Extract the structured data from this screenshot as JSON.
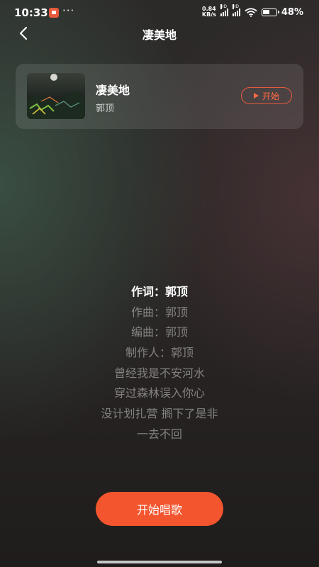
{
  "status_bar": {
    "time": "10:33",
    "more": "···",
    "net_speed_value": "0.84",
    "net_speed_unit": "KB/s",
    "signal1_tag": "HD",
    "signal2_tag": "HD",
    "battery": "48%"
  },
  "nav": {
    "title": "凄美地",
    "back_icon": "chevron-left-icon"
  },
  "song_card": {
    "title": "凄美地",
    "artist": "郭顶",
    "start_label": "开始",
    "play_icon": "play-icon"
  },
  "lyrics": [
    "作词：郭顶",
    "作曲：郭顶",
    "编曲：郭顶",
    "制作人：郭顶",
    "曾经我是不安河水",
    "穿过森林误入你心",
    "没计划扎营 搁下了是非",
    "一去不回"
  ],
  "actions": {
    "sing_label": "开始唱歌"
  },
  "colors": {
    "accent": "#f3552f",
    "start_outline": "#e8593d"
  }
}
